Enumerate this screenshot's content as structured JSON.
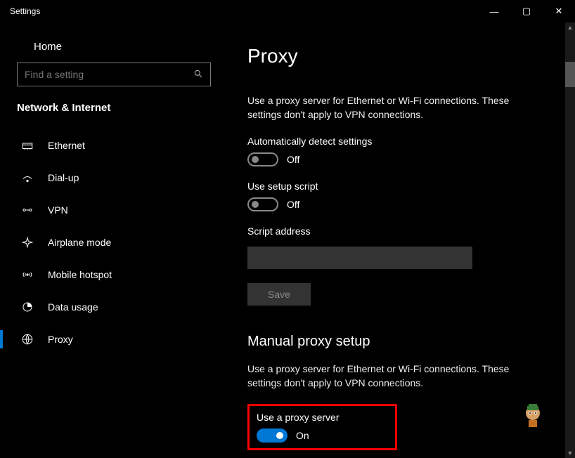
{
  "window": {
    "title": "Settings"
  },
  "titlebar": {
    "min": "—",
    "max": "▢",
    "close": "✕"
  },
  "sidebar": {
    "home": "Home",
    "search_placeholder": "Find a setting",
    "section": "Network & Internet",
    "items": [
      {
        "label": "Ethernet"
      },
      {
        "label": "Dial-up"
      },
      {
        "label": "VPN"
      },
      {
        "label": "Airplane mode"
      },
      {
        "label": "Mobile hotspot"
      },
      {
        "label": "Data usage"
      },
      {
        "label": "Proxy"
      }
    ]
  },
  "page": {
    "title": "Proxy",
    "desc1": "Use a proxy server for Ethernet or Wi-Fi connections. These settings don't apply to VPN connections.",
    "auto_detect": {
      "label": "Automatically detect settings",
      "state": "Off"
    },
    "setup_script": {
      "label": "Use setup script",
      "state": "Off"
    },
    "script_address_label": "Script address",
    "script_address_value": "",
    "save": "Save",
    "manual_title": "Manual proxy setup",
    "desc2": "Use a proxy server for Ethernet or Wi-Fi connections. These settings don't apply to VPN connections.",
    "use_proxy": {
      "label": "Use a proxy server",
      "state": "On"
    }
  }
}
